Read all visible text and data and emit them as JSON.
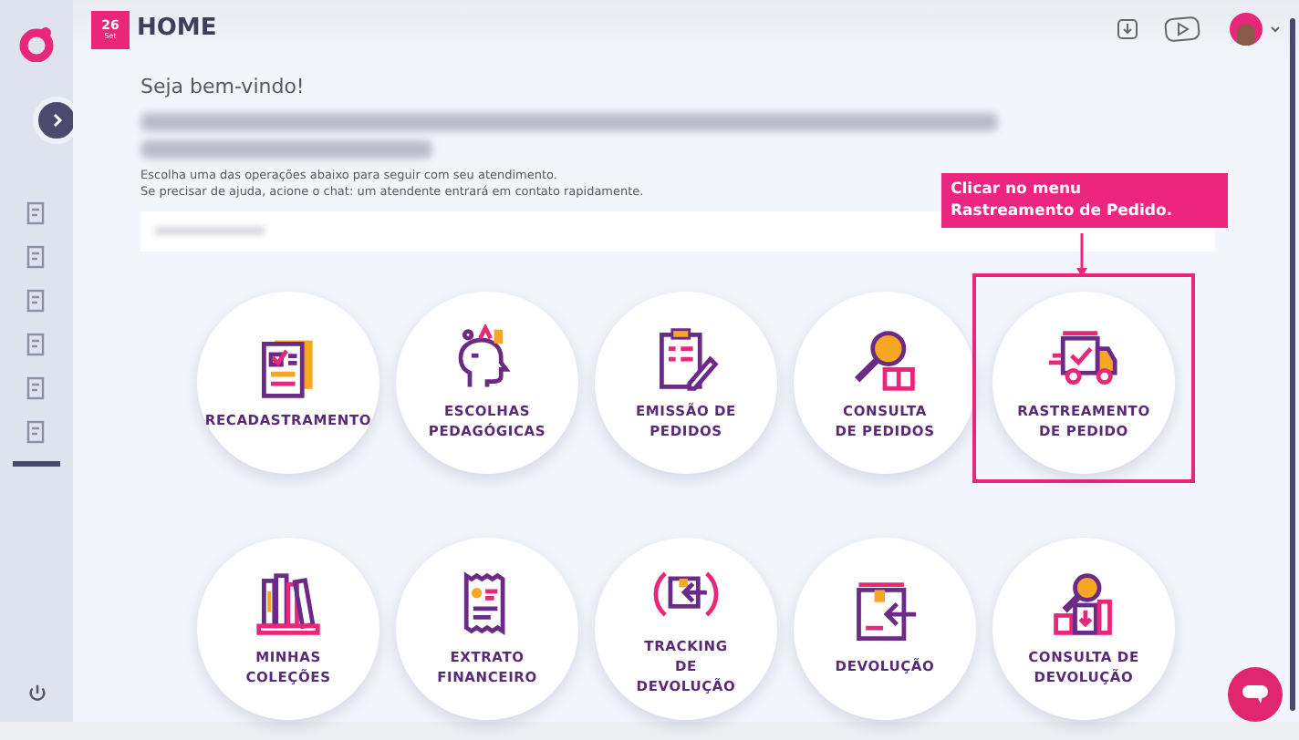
{
  "header": {
    "date_day": "26",
    "date_month": "Set",
    "title": "HOME"
  },
  "welcome": {
    "title": "Seja bem-vindo!",
    "lines": [
      "Escolha uma das operações abaixo para seguir com seu atendimento.",
      "Se precisar de ajuda, acione o chat: um atendente entrará em contato rapidamente."
    ]
  },
  "callout": {
    "text": "Clicar no menu\nRastreamento de Pedido."
  },
  "tiles": [
    {
      "label": "RECADASTRAMENTO",
      "highlighted": false
    },
    {
      "label": "ESCOLHAS\nPEDAGÓGICAS",
      "highlighted": false
    },
    {
      "label": "EMISSÃO DE\nPEDIDOS",
      "highlighted": false
    },
    {
      "label": "CONSULTA\nDE PEDIDOS",
      "highlighted": false
    },
    {
      "label": "RASTREAMENTO\nDE PEDIDO",
      "highlighted": true
    },
    {
      "label": "MINHAS\nCOLEÇÕES",
      "highlighted": false
    },
    {
      "label": "EXTRATO\nFINANCEIRO",
      "highlighted": false
    },
    {
      "label": "TRACKING\nDE\nDEVOLUÇÃO",
      "highlighted": false
    },
    {
      "label": "DEVOLUÇÃO",
      "highlighted": false
    },
    {
      "label": "CONSULTA DE\nDEVOLUÇÃO",
      "highlighted": false
    }
  ]
}
